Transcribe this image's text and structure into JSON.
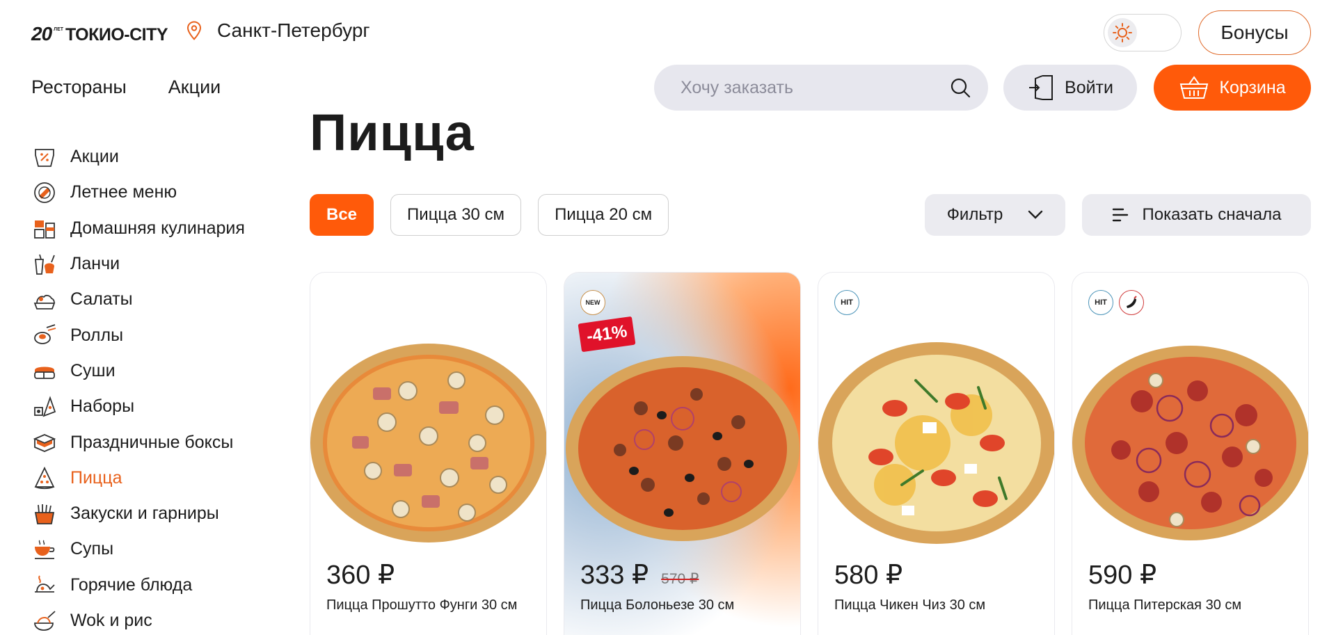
{
  "header": {
    "logo": {
      "number": "20",
      "sub": "ЛЕТ",
      "name": "ТОКИО-CITY"
    },
    "city": "Санкт-Петербург",
    "bonus_label": "Бонусы",
    "nav": [
      "Рестораны",
      "Акции"
    ],
    "search_placeholder": "Хочу заказать",
    "login_label": "Войти",
    "cart_label": "Корзина"
  },
  "colors": {
    "accent": "#ff5a0a",
    "active_text": "#e8611c",
    "discount": "#e0122a"
  },
  "sidebar": {
    "items": [
      {
        "label": "Акции",
        "icon": "promo-icon",
        "active": false
      },
      {
        "label": "Летнее меню",
        "icon": "summer-menu-icon",
        "active": false
      },
      {
        "label": "Домашняя кулинария",
        "icon": "home-cooking-icon",
        "active": false
      },
      {
        "label": "Ланчи",
        "icon": "lunch-icon",
        "active": false
      },
      {
        "label": "Салаты",
        "icon": "salad-icon",
        "active": false
      },
      {
        "label": "Роллы",
        "icon": "rolls-icon",
        "active": false
      },
      {
        "label": "Суши",
        "icon": "sushi-icon",
        "active": false
      },
      {
        "label": "Наборы",
        "icon": "sets-icon",
        "active": false
      },
      {
        "label": "Праздничные боксы",
        "icon": "box-icon",
        "active": false
      },
      {
        "label": "Пицца",
        "icon": "pizza-icon",
        "active": true
      },
      {
        "label": "Закуски и гарниры",
        "icon": "snacks-icon",
        "active": false
      },
      {
        "label": "Супы",
        "icon": "soup-icon",
        "active": false
      },
      {
        "label": "Горячие блюда",
        "icon": "hot-dish-icon",
        "active": false
      },
      {
        "label": "Wok и рис",
        "icon": "wok-icon",
        "active": false
      }
    ]
  },
  "main": {
    "title": "Пицца",
    "chips": [
      {
        "label": "Все",
        "active": true
      },
      {
        "label": "Пицца 30 см",
        "active": false
      },
      {
        "label": "Пицца 20 см",
        "active": false
      }
    ],
    "filter_label": "Фильтр",
    "sort_label": "Показать сначала",
    "products": [
      {
        "price": "360 ₽",
        "old_price": "",
        "name": "Пицца Прошутто Фунги 30 см",
        "badges": [],
        "discount": ""
      },
      {
        "price": "333 ₽",
        "old_price": "570 ₽",
        "name": "Пицца Болоньезе 30 см",
        "badges": [
          "NEW"
        ],
        "discount": "-41%"
      },
      {
        "price": "580 ₽",
        "old_price": "",
        "name": "Пицца Чикен Чиз 30 см",
        "badges": [
          "HIT"
        ],
        "discount": ""
      },
      {
        "price": "590 ₽",
        "old_price": "",
        "name": "Пицца Питерская 30 см",
        "badges": [
          "HIT",
          "spicy"
        ],
        "discount": ""
      }
    ]
  }
}
